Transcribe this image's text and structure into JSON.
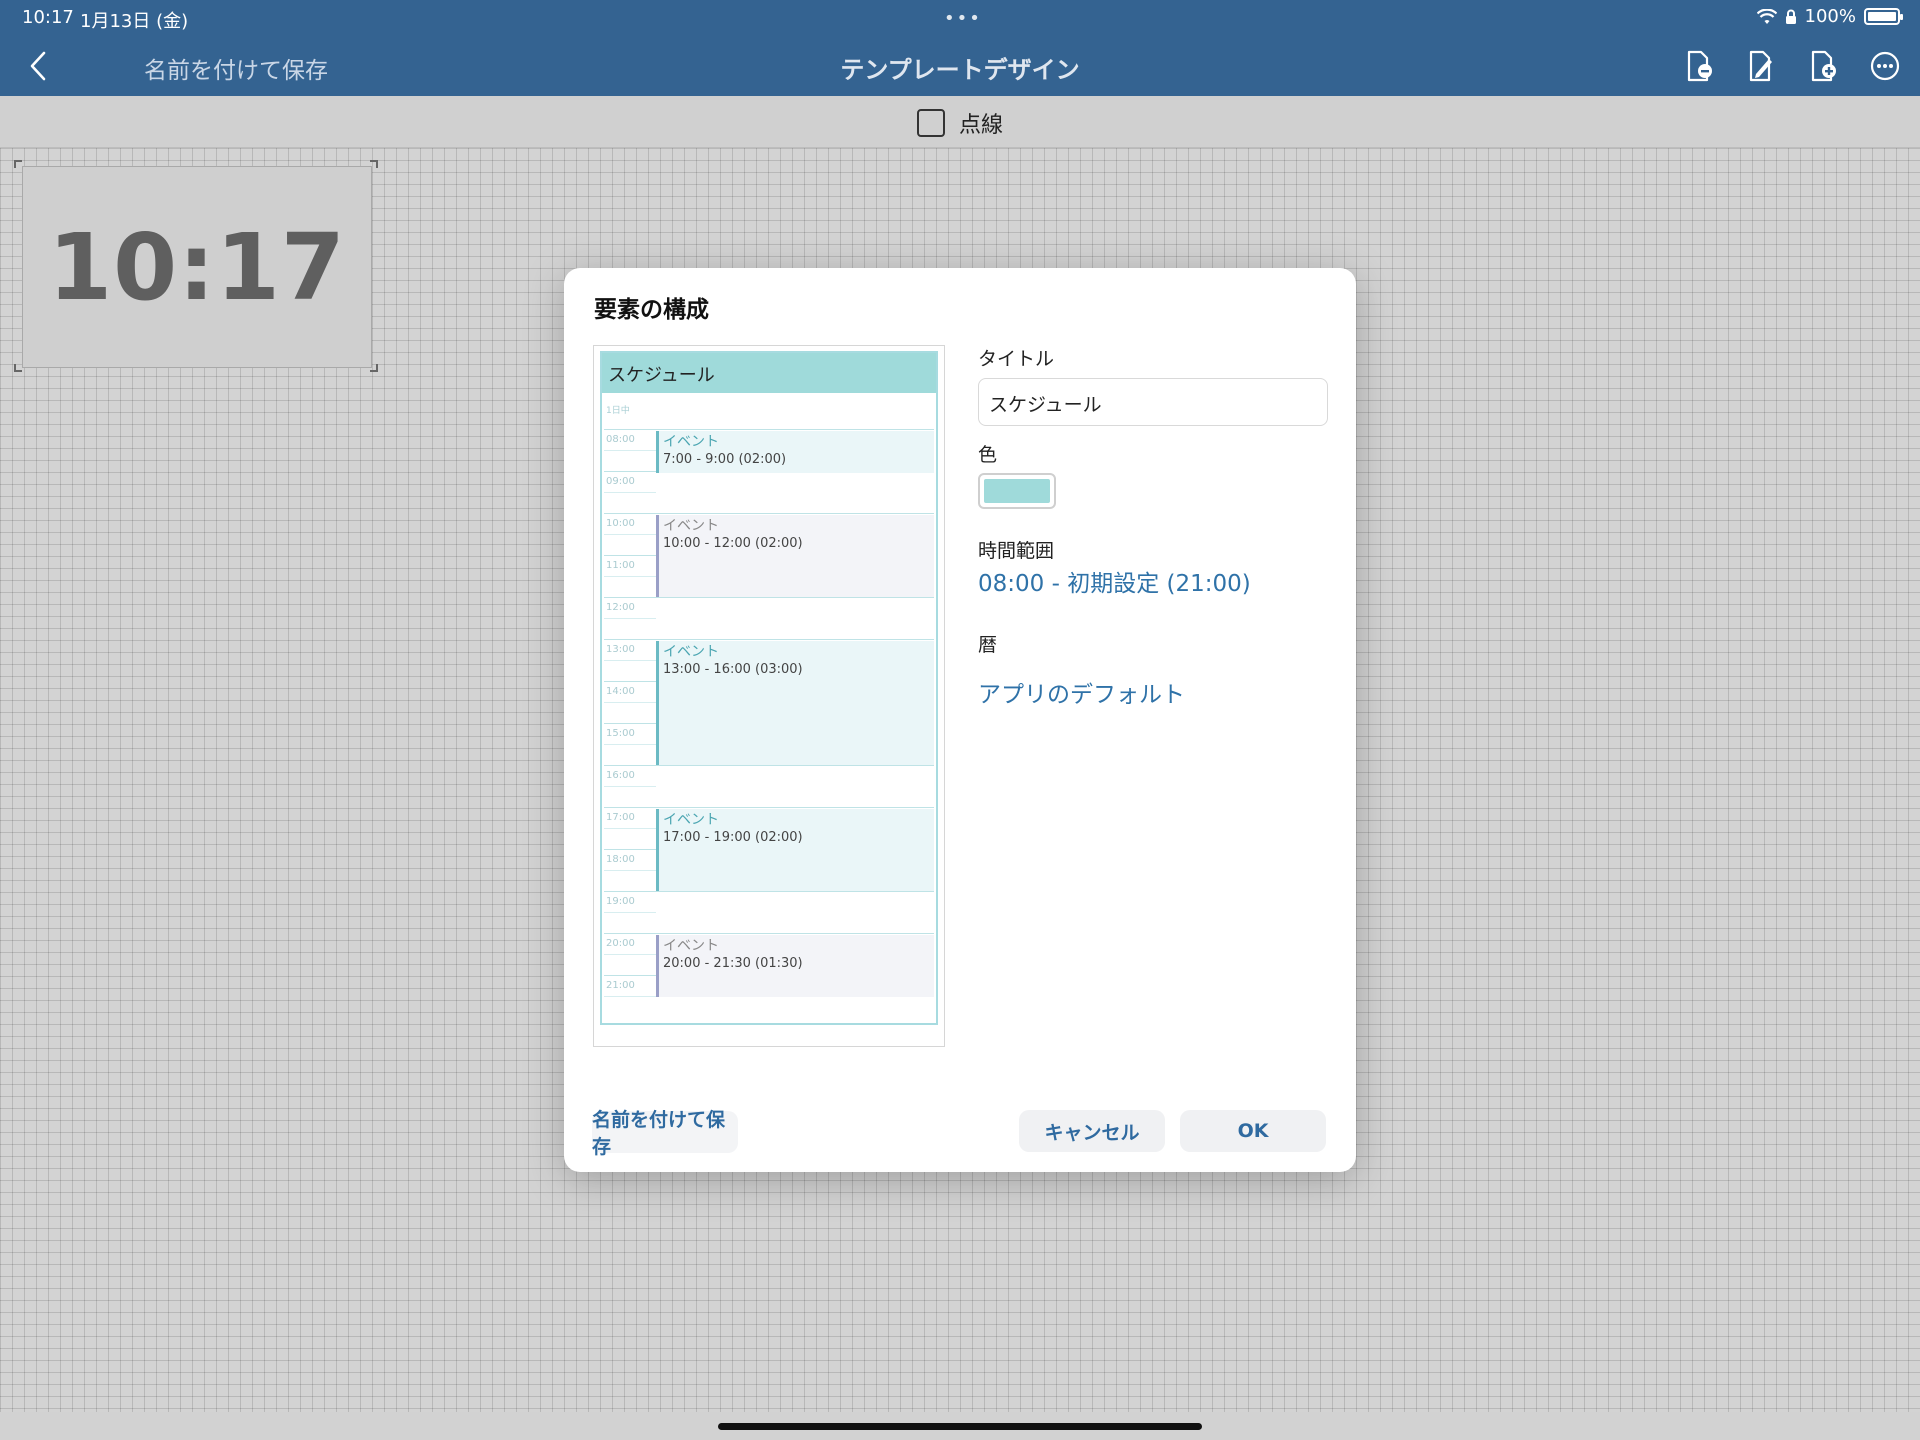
{
  "status_bar": {
    "time": "10:17",
    "date": "1月13日 (金)",
    "battery": "100%"
  },
  "nav": {
    "back_icon": "chevron-left-icon",
    "save_as": "名前を付けて保存",
    "title": "テンプレートデザイン",
    "tool_icons": [
      "page-minus-icon",
      "page-edit-icon",
      "page-add-icon",
      "more-icon"
    ]
  },
  "subbar": {
    "dashed_label": "点線",
    "dashed_checked": false
  },
  "canvas": {
    "clock_text": "10:17"
  },
  "dialog": {
    "title": "要素の構成",
    "preview": {
      "header": "スケジュール",
      "allday_label": "1日中",
      "hours": [
        "08:00",
        "09:00",
        "10:00",
        "11:00",
        "12:00",
        "13:00",
        "14:00",
        "15:00",
        "16:00",
        "17:00",
        "18:00",
        "19:00",
        "20:00",
        "21:00"
      ],
      "events": [
        {
          "title": "イベント",
          "time": "7:00 - 9:00 (02:00)"
        },
        {
          "title": "イベント",
          "time": "10:00 - 12:00 (02:00)"
        },
        {
          "title": "イベント",
          "time": "13:00 - 16:00 (03:00)"
        },
        {
          "title": "イベント",
          "time": "17:00 - 19:00 (02:00)"
        },
        {
          "title": "イベント",
          "time": "20:00 - 21:30 (01:30)"
        }
      ]
    },
    "fields": {
      "title_label": "タイトル",
      "title_value": "スケジュール",
      "color_label": "色",
      "color_value": "#9fdada",
      "time_range_label": "時間範囲",
      "time_range_value": "08:00 - 初期設定 (21:00)",
      "calendar_label": "暦",
      "calendar_value": "アプリのデフォルト"
    },
    "buttons": {
      "save_as": "名前を付けて保存",
      "cancel": "キャンセル",
      "ok": "OK"
    }
  }
}
